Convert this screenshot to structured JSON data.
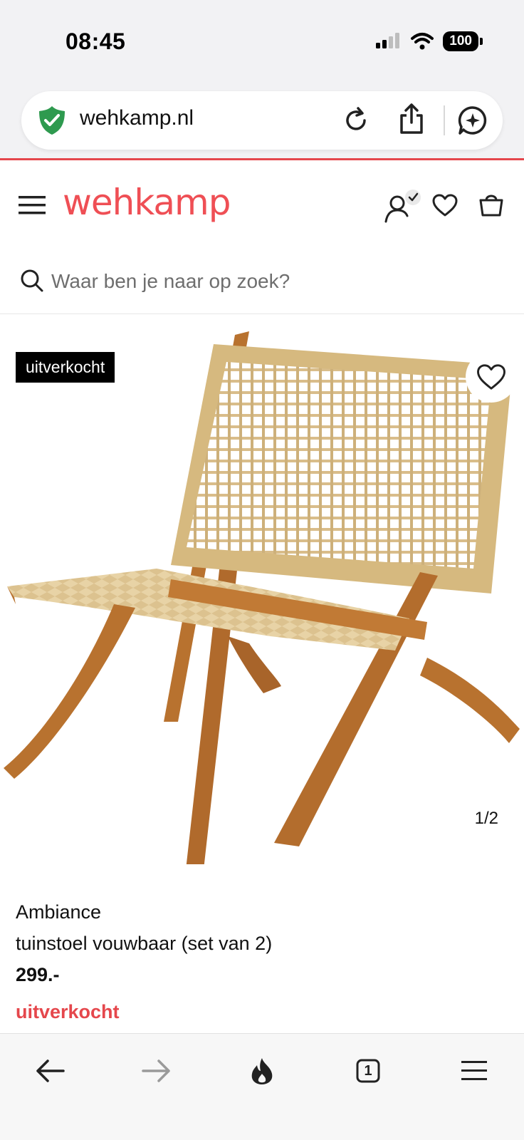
{
  "status_bar": {
    "time": "08:45",
    "battery": "100"
  },
  "browser": {
    "url": "wehkamp.nl",
    "tab_count": "1"
  },
  "site": {
    "logo": "wehkamp",
    "search": {
      "placeholder": "Waar ben je naar op zoek?"
    }
  },
  "product": {
    "badge": "uitverkocht",
    "pager": "1/2",
    "brand": "Ambiance",
    "name": "tuinstoel vouwbaar (set van 2)",
    "price": "299.-",
    "stock_status": "uitverkocht"
  },
  "colors": {
    "brand": "#ef4f55",
    "accent_line": "#e5474c"
  },
  "icons": [
    "shield-check-icon",
    "reload-icon",
    "share-icon",
    "ai-chat-icon",
    "hamburger-menu-icon",
    "account-icon",
    "heart-icon",
    "shopping-bag-icon",
    "search-icon",
    "back-arrow-icon",
    "forward-arrow-icon",
    "flame-icon",
    "tabs-icon",
    "menu-icon"
  ]
}
